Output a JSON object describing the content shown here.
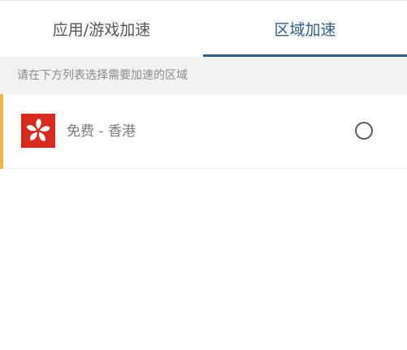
{
  "tabs": {
    "app_game": "应用/游戏加速",
    "region": "区域加速"
  },
  "hint": "请在下方列表选择需要加速的区域",
  "regions": [
    {
      "label": "免费 - 香港",
      "flag_icon": "hong-kong-flag-icon",
      "selected": false
    }
  ],
  "colors": {
    "active_tab": "#2f5f86",
    "tab_indicator": "#355c80",
    "row_accent": "#f2b24b",
    "flag_red": "#d82a1f"
  }
}
